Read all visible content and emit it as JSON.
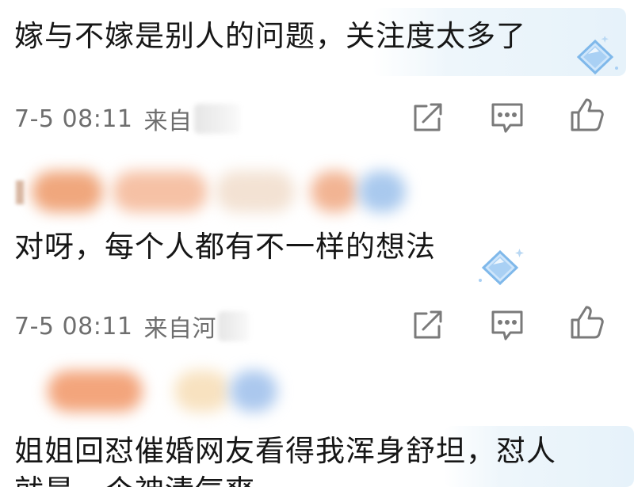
{
  "comments": [
    {
      "text": "嫁与不嫁是别人的问题，关注度太多了",
      "time": "7-5 08:11",
      "location_prefix": "来自",
      "location_visible": ""
    },
    {
      "text": "对呀，每个人都有不一样的想法",
      "time": "7-5 08:11",
      "location_prefix": "来自河",
      "location_visible": ""
    },
    {
      "text": "姐姐回怼催婚网友看得我浑身舒坦，怼人",
      "text_line2": "就是一个神清气爽",
      "time": "",
      "location_prefix": ""
    }
  ],
  "icons": {
    "share": "share-icon",
    "comment": "comment-icon",
    "like": "like-icon",
    "badge": "diamond-badge-icon"
  },
  "colors": {
    "meta_text": "#6e6e6e",
    "icon_stroke": "#7a7a7a",
    "badge_blue": "#7fb8ea"
  }
}
